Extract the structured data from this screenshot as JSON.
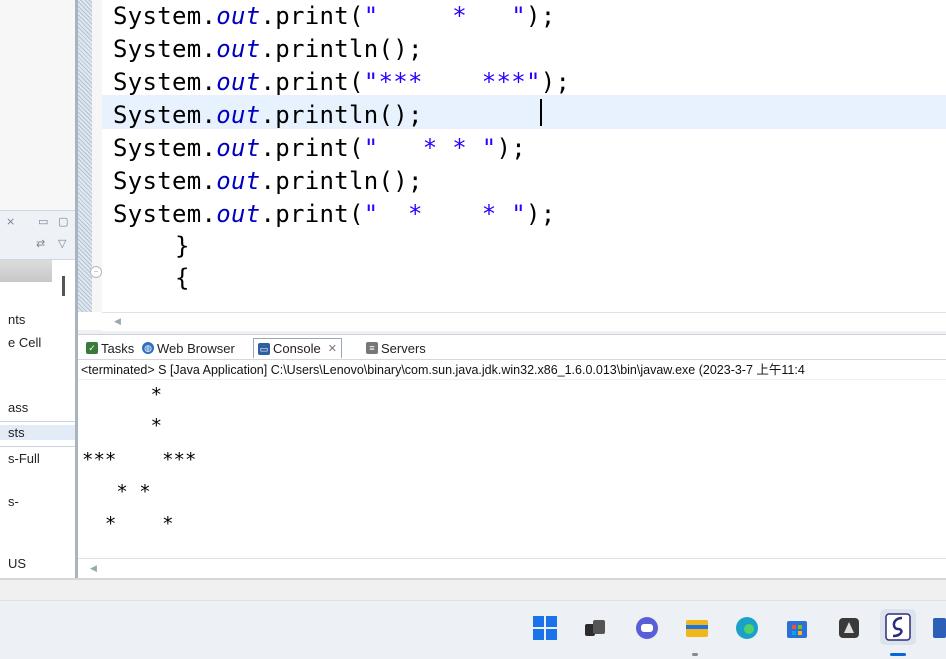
{
  "editor": {
    "lines": [
      {
        "prefix": "System.",
        "out": "out",
        "method": ".print(",
        "str": "\"     *   \"",
        "suffix": ");"
      },
      {
        "prefix": "System.",
        "out": "out",
        "method": ".println",
        "str": "",
        "suffix": "();"
      },
      {
        "prefix": "System.",
        "out": "out",
        "method": ".print(",
        "str": "\"***    ***\"",
        "suffix": ");"
      },
      {
        "prefix": "System.",
        "out": "out",
        "method": ".println",
        "str": "",
        "suffix": "();"
      },
      {
        "prefix": "System.",
        "out": "out",
        "method": ".print(",
        "str": "\"   * * \"",
        "suffix": ");"
      },
      {
        "prefix": "System.",
        "out": "out",
        "method": ".println",
        "str": "",
        "suffix": "();"
      },
      {
        "prefix": "System.",
        "out": "out",
        "method": ".print(",
        "str": "\"  *    * \"",
        "suffix": ");"
      }
    ],
    "brace_close": "}",
    "brace_open": "{"
  },
  "left_panel": {
    "items": [
      "nts",
      "e Cell",
      "ass",
      "sts",
      "s-Full",
      "s-",
      "US"
    ]
  },
  "console": {
    "tabs": [
      {
        "label": "Tasks",
        "icon": "tasks-icon",
        "color": "#3a7a3a"
      },
      {
        "label": "Web Browser",
        "icon": "globe-icon",
        "color": "#2f6fbf"
      },
      {
        "label": "Console",
        "icon": "console-icon",
        "color": "#2f5fa0",
        "active": true
      },
      {
        "label": "Servers",
        "icon": "servers-icon",
        "color": "#777777"
      }
    ],
    "close_glyph": "✕",
    "status": "<terminated> S [Java Application] C:\\Users\\Lenovo\\binary\\com.sun.java.jdk.win32.x86_1.6.0.013\\bin\\javaw.exe (2023-3-7 上午11:4",
    "output": [
      "      *",
      "      *",
      "***    ***",
      "   * *",
      "  *    *"
    ]
  },
  "taskbar": {
    "apps": [
      {
        "name": "windows-start-icon",
        "color": "#1a73e8"
      },
      {
        "name": "task-view-icon",
        "color": "#2b2b2b"
      },
      {
        "name": "chat-icon",
        "color": "#5b5fd6"
      },
      {
        "name": "file-explorer-icon",
        "color": "#f2b51a"
      },
      {
        "name": "edge-browser-icon",
        "color": "#1ba0c8"
      },
      {
        "name": "store-icon",
        "color": "#2b6fd8"
      },
      {
        "name": "app-icon",
        "color": "#3a3a3a"
      },
      {
        "name": "eclipse-icon",
        "color": "#2c2c7a"
      },
      {
        "name": "word-icon",
        "color": "#2b5fb8"
      }
    ]
  }
}
